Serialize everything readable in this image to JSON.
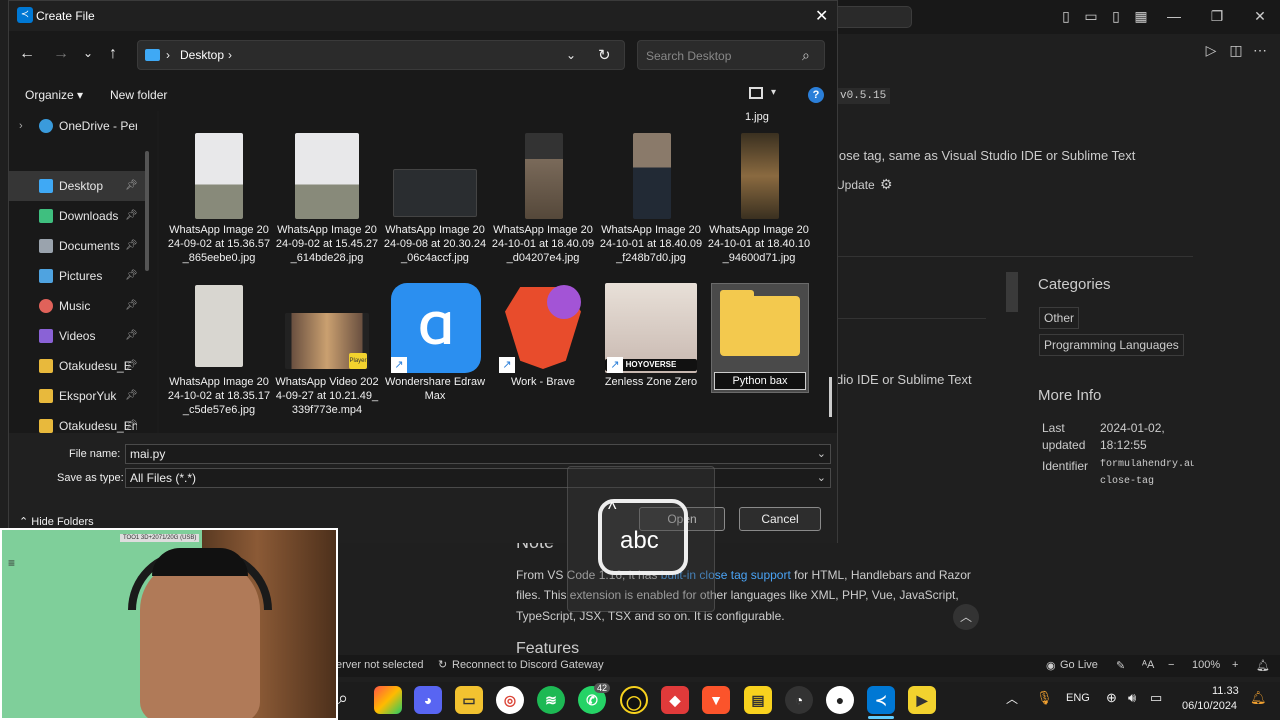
{
  "dialog": {
    "title": "Create File",
    "address": {
      "location": "Desktop"
    },
    "search_placeholder": "Search Desktop",
    "commands": {
      "organize": "Organize",
      "new_folder": "New folder"
    },
    "sidebar": [
      {
        "label": "OneDrive - Perso",
        "color": "#3a9bdc",
        "pinned": false
      },
      {
        "label": "Desktop",
        "color": "#3fa9f5",
        "pinned": true,
        "selected": true
      },
      {
        "label": "Downloads",
        "color": "#3fbf7f",
        "pinned": true
      },
      {
        "label": "Documents",
        "color": "#9aa3ad",
        "pinned": true
      },
      {
        "label": "Pictures",
        "color": "#4fa3e0",
        "pinned": true
      },
      {
        "label": "Music",
        "color": "#e0625a",
        "pinned": true
      },
      {
        "label": "Videos",
        "color": "#8a62d6",
        "pinned": true
      },
      {
        "label": "Otakudesu_E",
        "color": "#e8b93c",
        "pinned": true
      },
      {
        "label": "EksporYuk",
        "color": "#e8b93c",
        "pinned": true
      },
      {
        "label": "Otakudesu_EnS.",
        "color": "#e8b93c",
        "pinned": true
      }
    ],
    "partial_top_file": "1.jpg",
    "files_row1": [
      {
        "name": "WhatsApp Image 2024-09-02 at 15.36.57_865eebe0.jpg"
      },
      {
        "name": "WhatsApp Image 2024-09-02 at 15.45.27_614bde28.jpg"
      },
      {
        "name": "WhatsApp Image 2024-09-08 at 20.30.24_06c4accf.jpg"
      },
      {
        "name": "WhatsApp Image 2024-10-01 at 18.40.09_d04207e4.jpg"
      },
      {
        "name": "WhatsApp Image 2024-10-01 at 18.40.09_f248b7d0.jpg"
      },
      {
        "name": "WhatsApp Image 2024-10-01 at 18.40.10_94600d71.jpg"
      }
    ],
    "files_row2": [
      {
        "name": "WhatsApp Image 2024-10-02 at 18.35.17_c5de57e6.jpg"
      },
      {
        "name": "WhatsApp Video 2024-09-27 at 10.21.49_339f773e.mp4"
      },
      {
        "name": "Wondershare EdrawMax"
      },
      {
        "name": "Work - Brave"
      },
      {
        "name": "Zenless Zone Zero"
      },
      {
        "name": "Python bax"
      }
    ],
    "zzz_banner": "HOYOVERSE",
    "player_badge": "Player",
    "file_name_label": "File name:",
    "file_name_value": "mai.py",
    "save_type_label": "Save as type:",
    "save_type_value": "All Files (*.*)",
    "hide_folders": "Hide Folders",
    "open_button": "Open",
    "cancel_button": "Cancel"
  },
  "vscode": {
    "version": "v0.5.15",
    "description": "lose tag, same as Visual Studio IDE or Sublime Text",
    "update": "Update",
    "desc2": "dio IDE or Sublime Text",
    "categories_title": "Categories",
    "categories": [
      "Other",
      "Programming Languages"
    ],
    "more_info_title": "More Info",
    "last_updated_label1": "Last",
    "last_updated_label2": "updated",
    "last_updated_value1": "2024-01-02,",
    "last_updated_value2": "18:12:55",
    "identifier_label": "Identifier",
    "identifier_value1": "formulahendry.auto-",
    "identifier_value2": "close-tag",
    "note_heading": "Note",
    "note_prefix": "From VS Code 1.16, it has ",
    "note_link": "built-in close tag support",
    "note_suffix": " for HTML, Handlebars and Razor",
    "note_line2": "files. This extension is enabled for other languages like XML, PHP, Vue, JavaScript,",
    "note_line3": "TypeScript, JSX, TSX and so on. It is configurable.",
    "features_heading": "Features"
  },
  "statusbar": {
    "server": "erver not selected",
    "reconnect": "Reconnect to Discord Gateway",
    "golive": "Go Live",
    "zoom": "100%"
  },
  "taskbar": {
    "language": "ENG",
    "time": "11.33",
    "date": "06/10/2024",
    "badge": "42"
  },
  "overlay": {
    "abc": "abc",
    "webcam_label": "TOO1 3D+2071/20G (USB)"
  }
}
